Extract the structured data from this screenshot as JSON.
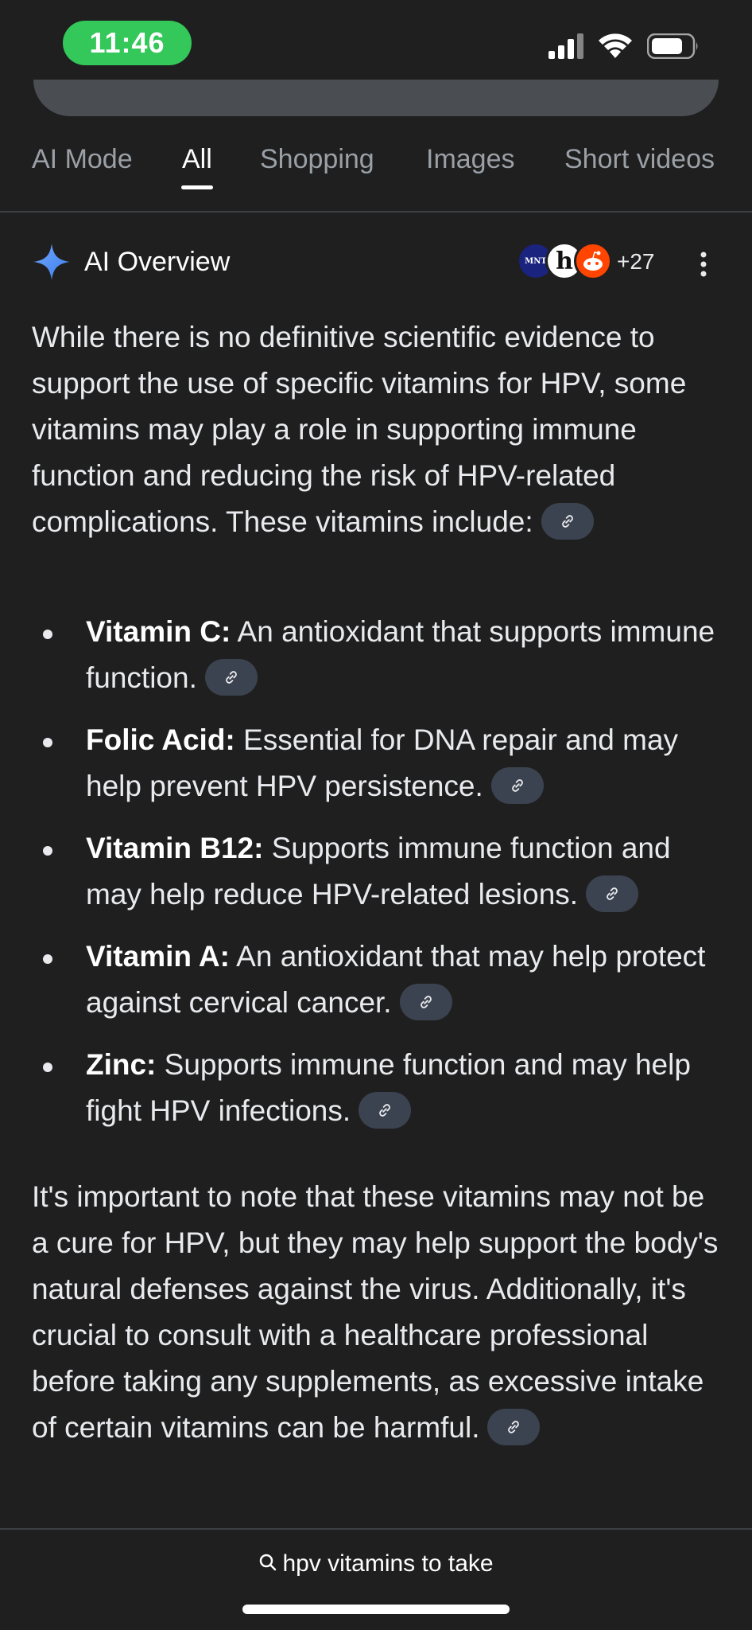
{
  "status_bar": {
    "time": "11:46",
    "icons": [
      "signal-icon",
      "wifi-icon",
      "battery-icon"
    ]
  },
  "tabs": [
    {
      "label": "AI Mode",
      "active": false
    },
    {
      "label": "All",
      "active": true
    },
    {
      "label": "Shopping",
      "active": false
    },
    {
      "label": "Images",
      "active": false
    },
    {
      "label": "Short videos",
      "active": false
    }
  ],
  "ai_overview": {
    "title": "AI Overview",
    "sources": {
      "avatars": [
        "MNT",
        "h",
        "reddit-icon"
      ],
      "more_count": "+27"
    },
    "intro": "While there is no definitive scientific evidence to support the use of specific vitamins for HPV, some vitamins may play a role in supporting immune function and reducing the risk of HPV-related complications. These vitamins include:",
    "items": [
      {
        "term": "Vitamin C:",
        "text": " An antioxidant that supports immune function."
      },
      {
        "term": "Folic Acid:",
        "text": " Essential for DNA repair and may help prevent HPV persistence."
      },
      {
        "term": "Vitamin B12:",
        "text": " Supports immune function and may help reduce HPV-related lesions."
      },
      {
        "term": "Vitamin A:",
        "text": " An antioxidant that may help protect against cervical cancer."
      },
      {
        "term": "Zinc:",
        "text": " Supports immune function and may help fight HPV infections."
      }
    ],
    "outro": "It's important to note that these vitamins may not be a cure for HPV, but they may help support the body's natural defenses against the virus. Additionally, it's crucial to consult with a healthcare professional before taking any supplements, as excessive intake of certain vitamins can be harmful."
  },
  "bottom": {
    "search_query": "hpv vitamins to take"
  },
  "colors": {
    "background": "#1f1f1f",
    "time_pill": "#34c759",
    "link_chip": "#3c4350",
    "sparkle": "#4285f4"
  }
}
